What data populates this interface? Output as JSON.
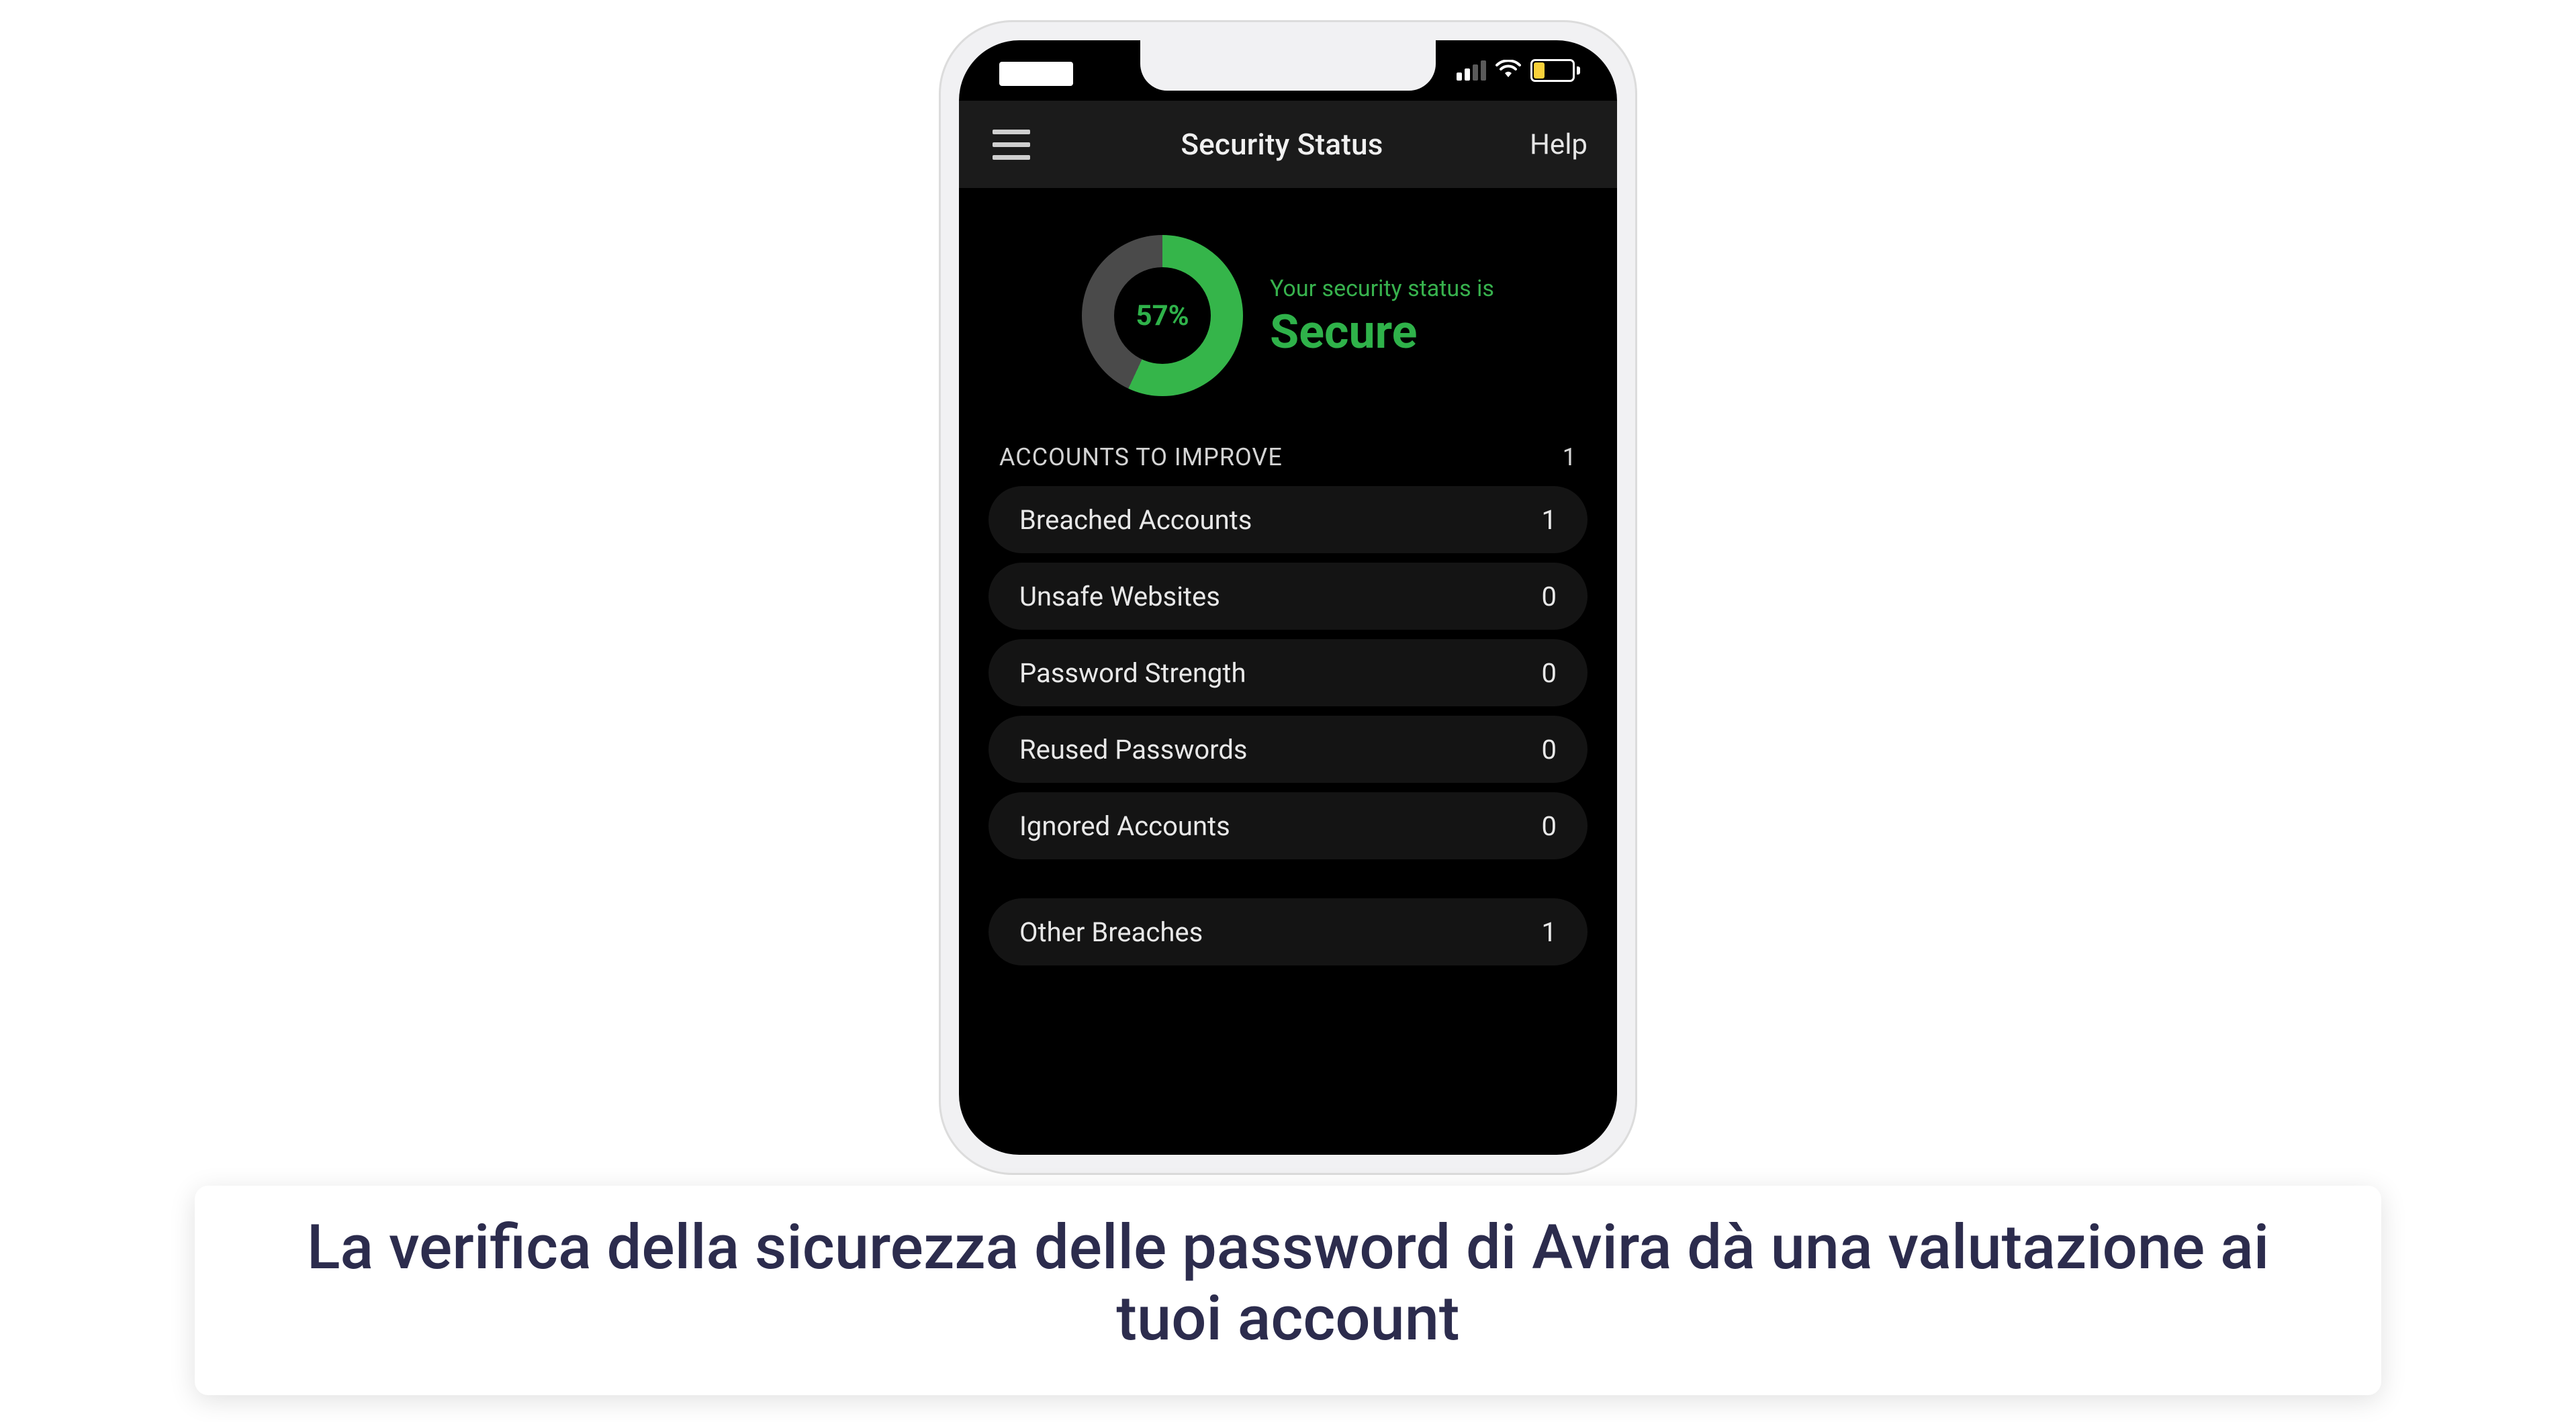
{
  "nav": {
    "title": "Security Status",
    "help": "Help"
  },
  "gauge": {
    "percent_label": "57%",
    "percent_value": 57
  },
  "status": {
    "line": "Your security status is",
    "big": "Secure"
  },
  "section": {
    "title": "ACCOUNTS TO IMPROVE",
    "count": "1"
  },
  "rows": [
    {
      "label": "Breached Accounts",
      "count": "1"
    },
    {
      "label": "Unsafe Websites",
      "count": "0"
    },
    {
      "label": "Password Strength",
      "count": "0"
    },
    {
      "label": "Reused Passwords",
      "count": "0"
    },
    {
      "label": "Ignored Accounts",
      "count": "0"
    }
  ],
  "rows2": [
    {
      "label": "Other Breaches",
      "count": "1"
    }
  ],
  "caption": "La verifica della sicurezza delle password di Avira dà una valutazione ai tuoi account",
  "colors": {
    "accent_green": "#2fb24a",
    "row_bg": "#141414",
    "nav_bg": "#1b1b1b"
  }
}
